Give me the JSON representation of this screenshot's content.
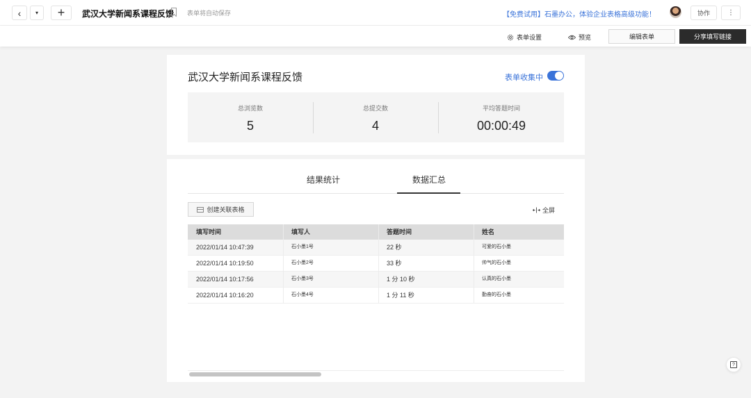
{
  "topbar": {
    "back_icon": "‹",
    "dropdown_icon": "▾",
    "add_icon": "+",
    "title": "武汉大学新闻系课程反馈",
    "autosave": "表单将自动保存",
    "promo": "【免费试用】石墨办公，体验企业表格高级功能！",
    "collab_label": "协作",
    "more_icon": "⋮"
  },
  "subbar": {
    "settings_label": "表单设置",
    "preview_label": "预览",
    "edit_label": "编辑表单",
    "share_label": "分享填写链接"
  },
  "form": {
    "title": "武汉大学新闻系课程反馈",
    "collecting_label": "表单收集中",
    "collecting_on": true,
    "stats": [
      {
        "label": "总浏览数",
        "value": "5"
      },
      {
        "label": "总提交数",
        "value": "4"
      },
      {
        "label": "平均答题时间",
        "value": "00:00:49"
      }
    ]
  },
  "tabs": [
    {
      "label": "结果统计",
      "active": false
    },
    {
      "label": "数据汇总",
      "active": true
    }
  ],
  "toolbar": {
    "create_table_label": "创建关联表格",
    "fullscreen_label": "全屏"
  },
  "table": {
    "headers": [
      "填写时间",
      "填写人",
      "答题时间",
      "姓名"
    ],
    "rows": [
      [
        "2022/01/14 10:47:39",
        "石小墨1号",
        "22 秒",
        "可爱的石小墨"
      ],
      [
        "2022/01/14 10:19:50",
        "石小墨2号",
        "33 秒",
        "帅气的石小墨"
      ],
      [
        "2022/01/14 10:17:56",
        "石小墨3号",
        "1 分 10 秒",
        "认真的石小墨"
      ],
      [
        "2022/01/14 10:16:20",
        "石小墨4号",
        "1 分 11 秒",
        "勤奋的石小墨"
      ]
    ]
  },
  "colors": {
    "accent": "#3a73d9",
    "share_button": "#2b2b2b",
    "header_bg": "#dcdcdc"
  }
}
